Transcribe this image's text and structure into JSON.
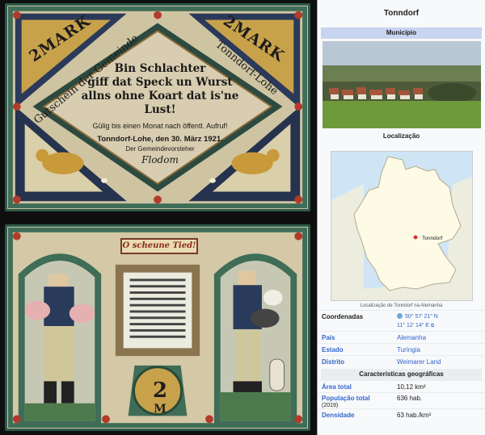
{
  "banknote": {
    "front": {
      "denomination": "2MARK",
      "issuer_arc": "Gutschein der Gemeinde",
      "place_arc": "Tonndorf-Lohe",
      "verse": [
        "Bin Schlachter",
        "giff dat Speck un Wurst",
        "allns ohne Koart dat is'ne Lust!"
      ],
      "validity": "Gülig bis einen Monat nach öffentl. Aufruf!",
      "dateline": "Tonndorf-Lohe, den 30. März 1921.",
      "signer": "Der Gemeindevorsteher",
      "signature": "Flodom"
    },
    "back": {
      "banner": "O scheune Tied!",
      "value": "2",
      "mark": "M"
    }
  },
  "infobox": {
    "title": "Tonndorf",
    "type": "Município",
    "location_heading": "Localização",
    "map_marker_label": "Tonndorf",
    "map_caption": "Localização de Tonndorf na Alemanha",
    "coordinates": {
      "label": "Coordenadas",
      "lat": "50° 57′ 21″ N",
      "lon": "11° 12′ 14″ E",
      "ext": "⧉"
    },
    "rows": [
      {
        "label": "País",
        "value": "Alemanha"
      },
      {
        "label": "Estado",
        "value": "Turíngia"
      },
      {
        "label": "Distrito",
        "value": "Weimarer Land"
      }
    ],
    "geo_section": "Características geográficas",
    "area": {
      "label": "Área total",
      "value": "10,12 km²"
    },
    "population": {
      "label": "População total",
      "year": "(2019)",
      "value": "636 hab."
    },
    "density": {
      "label": "Densidade",
      "value": "63 hab./km²"
    }
  },
  "colors": {
    "note_paper": "#cfc4a2",
    "note_border": "#2d5a4a",
    "infobox_type_bg": "#c8d4f0",
    "link": "#3366cc",
    "map_land": "#fdfbe6",
    "map_sea": "#cfe5f5",
    "marker": "#d33"
  }
}
